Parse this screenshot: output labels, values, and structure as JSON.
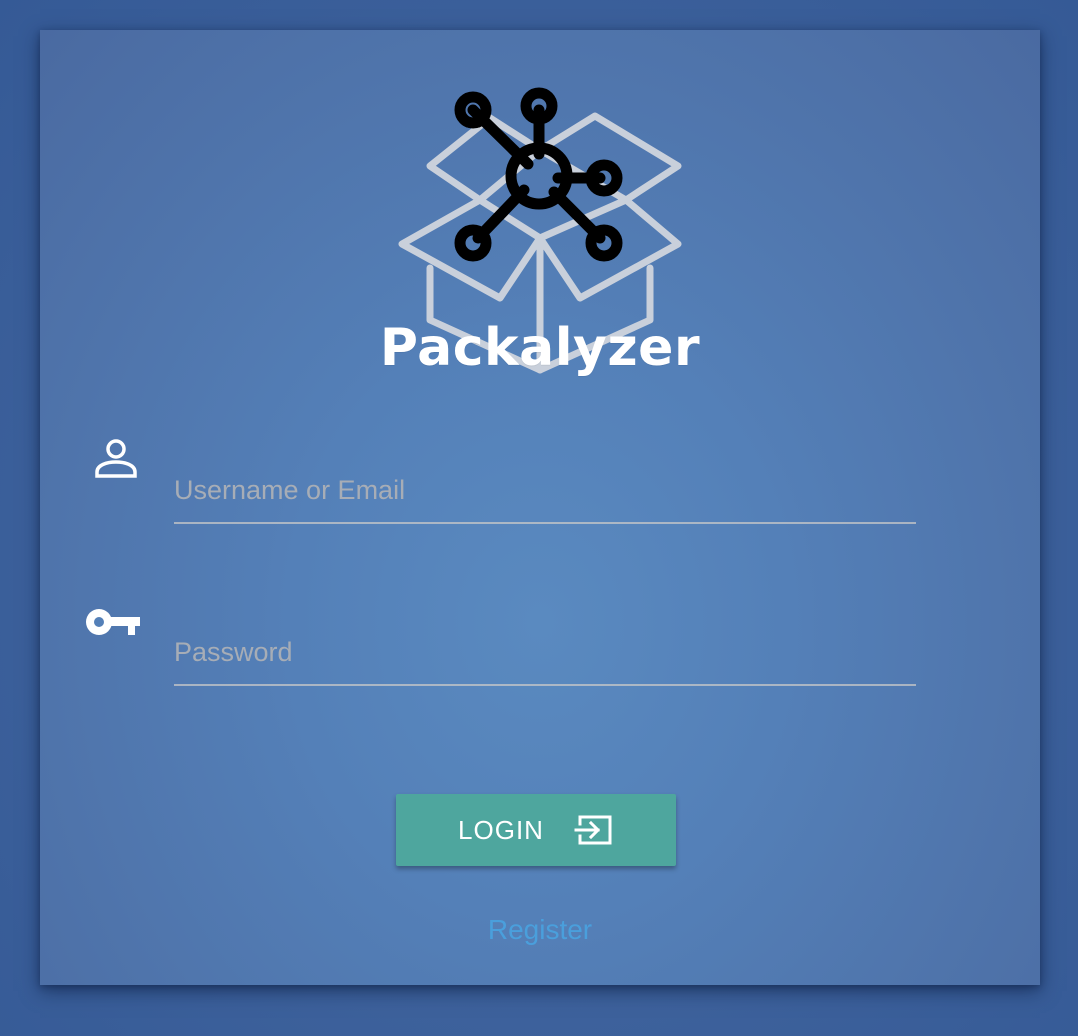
{
  "brand": {
    "name": "Packalyzer",
    "logo_icon": "open-box-network-hub-logo"
  },
  "form": {
    "username": {
      "icon": "user-icon",
      "placeholder": "Username or Email",
      "value": ""
    },
    "password": {
      "icon": "key-icon",
      "placeholder": "Password",
      "value": ""
    },
    "login_button": {
      "label": "LOGIN",
      "icon": "login-enter-icon"
    },
    "register_link": "Register"
  },
  "colors": {
    "background": "#3f639d",
    "card": "#5480b8",
    "button": "#4ea69e",
    "link": "#4a9fdc",
    "brand_text": "#ffffff"
  }
}
